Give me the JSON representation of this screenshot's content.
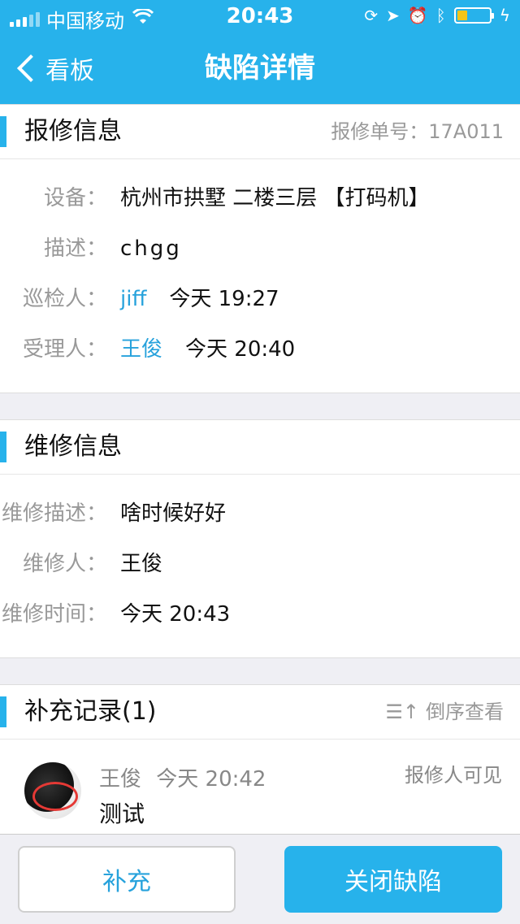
{
  "status_bar": {
    "carrier": "中国移动",
    "time": "20:43"
  },
  "nav": {
    "back_label": "看板",
    "title": "缺陷详情"
  },
  "report": {
    "section_title": "报修信息",
    "order_label": "报修单号：",
    "order_no": "17A011",
    "fields": [
      {
        "label": "设备：",
        "value": "杭州市拱墅 二楼三层 【打码机】"
      },
      {
        "label": "描述：",
        "value": "chgg"
      },
      {
        "label": "巡检人：",
        "person": "jiff",
        "time": "今天 19:27"
      },
      {
        "label": "受理人：",
        "person": "王俊",
        "time": "今天 20:40"
      }
    ]
  },
  "repair": {
    "section_title": "维修信息",
    "fields": [
      {
        "label": "维修描述：",
        "value": "啥时候好好"
      },
      {
        "label": "维修人：",
        "person": "王俊"
      },
      {
        "label": "维修时间：",
        "value": "今天 20:43"
      }
    ]
  },
  "records": {
    "section_title": "补充记录(1)",
    "sort_label": "倒序查看",
    "items": [
      {
        "author": "王俊",
        "time": "今天 20:42",
        "visibility": "报修人可见",
        "text": "测试"
      }
    ]
  },
  "actions": {
    "supplement_label": "补充",
    "close_label": "关闭缺陷"
  },
  "colors": {
    "accent": "#27b2eb",
    "link": "#27a2dc"
  }
}
